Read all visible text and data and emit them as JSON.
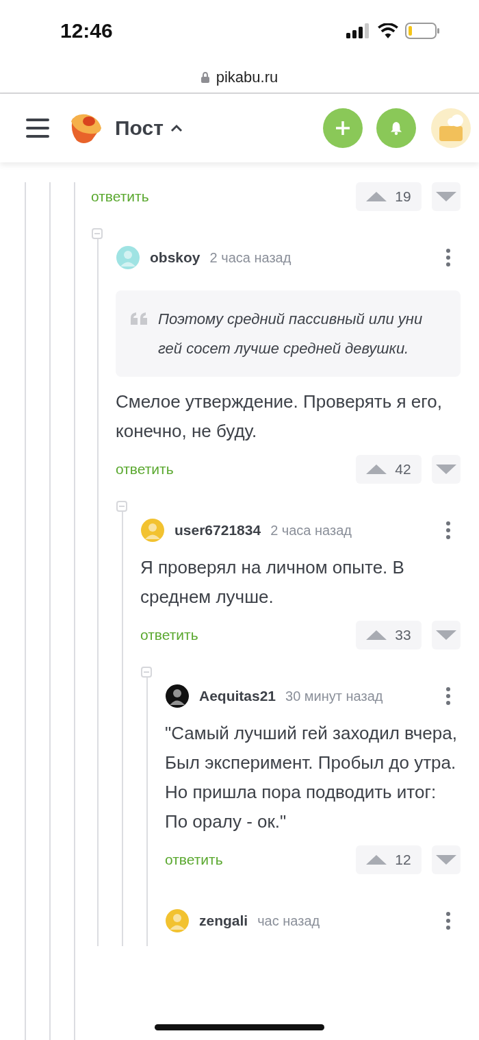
{
  "status_bar": {
    "time": "12:46"
  },
  "address_bar": {
    "url": "pikabu.ru"
  },
  "header": {
    "title": "Пост"
  },
  "thread": {
    "reply_label": "ответить",
    "score": "19",
    "children": [
      {
        "collapse_toggle": true,
        "author": "obskoy",
        "time": "2 часа назад",
        "color": "#9fe3e3",
        "quote": "Поэтому средний пассивный или уни гей сосет лучше средней девушки.",
        "text": "Смелое утверждение. Проверять я его, конечно, не буду.",
        "reply_label": "ответить",
        "score": "42",
        "children": [
          {
            "collapse_toggle": true,
            "author": "user6721834",
            "time": "2 часа назад",
            "color": "#f2c230",
            "text": "Я проверял на личном опыте. В среднем лучше.",
            "reply_label": "ответить",
            "score": "33",
            "children": [
              {
                "collapse_toggle": true,
                "author": "Aequitas21",
                "time": "30 минут назад",
                "color": "#111111",
                "text": "\"Самый лучший гей заходил вчера,\nБыл эксперимент. Пробыл до утра.\nНо пришла пора подводить итог:\nПо оралу - ок.\"",
                "reply_label": "ответить",
                "score": "12"
              },
              {
                "collapse_toggle": false,
                "author": "zengali",
                "time": "час назад",
                "color": "#f2c230"
              }
            ]
          }
        ]
      }
    ]
  }
}
